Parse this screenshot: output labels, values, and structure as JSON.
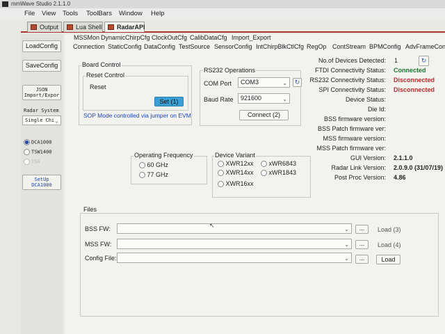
{
  "window": {
    "title": "mmWave Studio 2.1.1.0"
  },
  "menu": [
    "File",
    "View",
    "Tools",
    "ToolBars",
    "Window",
    "Help"
  ],
  "doc_tabs": [
    "Output",
    "Lua Shell",
    "RadarAPI"
  ],
  "left_panel": {
    "load_config": "LoadConfig",
    "save_config": "SaveConfig",
    "json_btn_line1": "JSON",
    "json_btn_line2": "Import/Expor",
    "radar_system_label": "Radar System",
    "radar_system_value": "Single Chi",
    "capture_options": [
      "DCA1000",
      "TSW1400",
      "TDA"
    ],
    "setup_line1": "SetUp",
    "setup_line2": "DCA1000"
  },
  "subtabs_row1": [
    "MSSMon",
    "DynamicChirpCfg",
    "ClockOutCfg",
    "CalibDataCfg",
    "Import_Export"
  ],
  "subtabs_row2": [
    "Connection",
    "StaticConfig",
    "DataConfig",
    "TestSource",
    "SensorConfig",
    "IntChirpBlkCtlCfg",
    "RegOp",
    "ContStream",
    "BPMConfig",
    "AdvFrameCon"
  ],
  "board_control": {
    "title": "Board Control",
    "reset_title": "Reset Control",
    "reset_label": "Reset",
    "set_button": "Set (1)",
    "sop_note": "SOP Mode controlled via jumper on EVM"
  },
  "rs232": {
    "title": "RS232 Operations",
    "com_port_label": "COM Port",
    "com_port_value": "COM3",
    "baud_label": "Baud Rate",
    "baud_value": "921600",
    "connect_button": "Connect (2)"
  },
  "operating_frequency": {
    "title": "Operating Frequency",
    "options": [
      "60 GHz",
      "77 GHz"
    ]
  },
  "device_variant": {
    "title": "Device Variant",
    "options": [
      "XWR12xx",
      "xWR6843",
      "XWR14xx",
      "xWR1843",
      "XWR16xx"
    ]
  },
  "status": {
    "devices_label": "No.of Devices Detected:",
    "devices_value": "1",
    "rows": [
      {
        "label": "FTDI Connectivity Status:",
        "value": "Connected"
      },
      {
        "label": "RS232 Connectivity Status:",
        "value": "Disconnected"
      },
      {
        "label": "SPI Connectivity Status:",
        "value": "Disconnected"
      },
      {
        "label": "Device Status:",
        "value": ""
      },
      {
        "label": "Die Id:",
        "value": ""
      },
      {
        "label": "BSS firmware version:",
        "value": ""
      },
      {
        "label": "BSS Patch firmware ver:",
        "value": ""
      },
      {
        "label": "MSS firmware version:",
        "value": ""
      },
      {
        "label": "MSS Patch firmware ver:",
        "value": ""
      },
      {
        "label": "GUI Version:",
        "value": "2.1.1.0"
      },
      {
        "label": "Radar Link Version:",
        "value": "2.0.9.0 (31/07/19)"
      },
      {
        "label": "Post Proc Version:",
        "value": "4.86"
      }
    ],
    "colors": {
      "connected": "#1c7a33",
      "disconnected": "#c42a2a"
    }
  },
  "files": {
    "title": "Files",
    "rows": [
      {
        "label": "BSS FW:",
        "value": "",
        "browse": "...",
        "action": "Load (3)"
      },
      {
        "label": "MSS FW:",
        "value": "",
        "browse": "...",
        "action": "Load (4)"
      },
      {
        "label": "Config File:",
        "value": "",
        "browse": "...",
        "action": "Load"
      }
    ]
  }
}
